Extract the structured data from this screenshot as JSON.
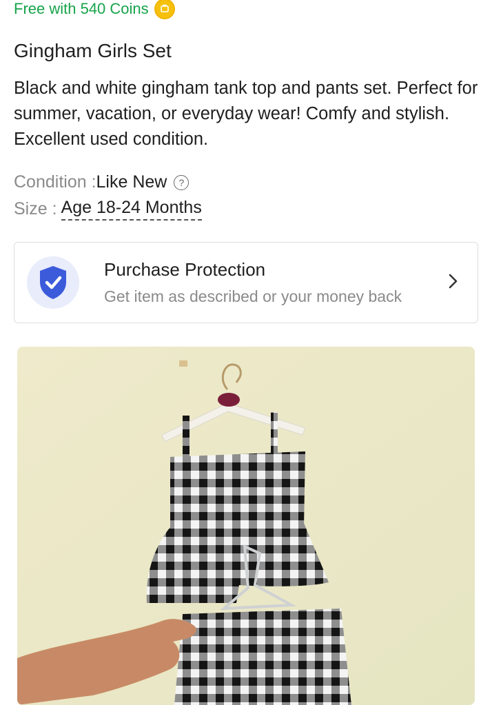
{
  "coins": {
    "text": "Free with 540 Coins",
    "icon": "coin-icon",
    "color": "#16a34a"
  },
  "title": "Gingham Girls Set",
  "description": "Black and white gingham tank top and pants set. Perfect for summer, vacation, or everyday wear! Comfy and stylish. Excellent used condition.",
  "condition": {
    "label": "Condition : ",
    "value": "Like New",
    "icon": "help-icon"
  },
  "size": {
    "label": "Size : ",
    "value": "Age 18-24 Months"
  },
  "protection": {
    "title": "Purchase Protection",
    "subtitle": "Get item as described or your money back",
    "icon": "shield-check-icon",
    "accent": "#3b5bdb"
  },
  "photo": {
    "icon": "product-photo"
  }
}
